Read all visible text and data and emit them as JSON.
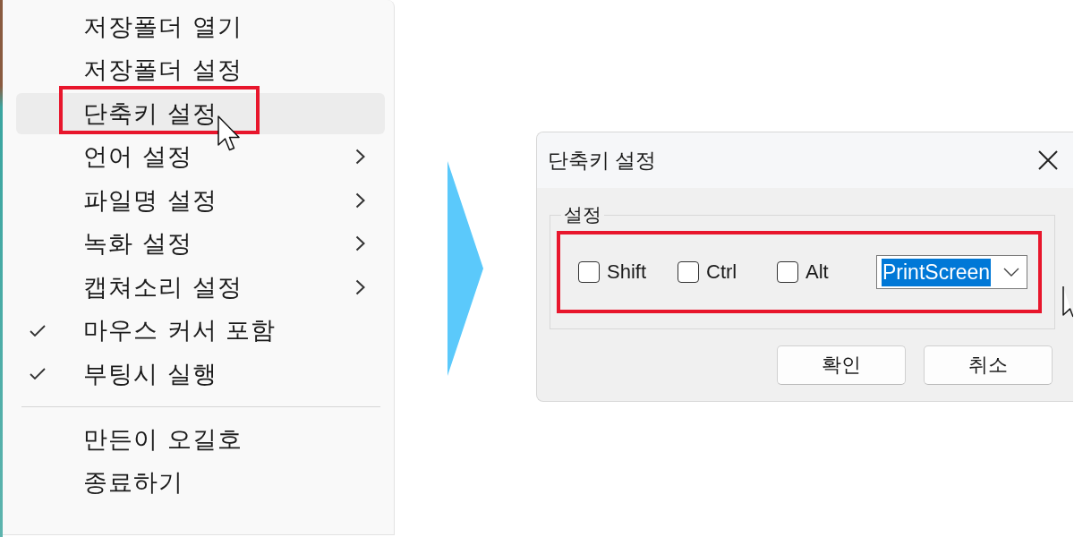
{
  "menu": {
    "items": [
      {
        "kind": "item",
        "label": "저장폴더 열기",
        "checked": false,
        "submenu": false,
        "selected": false,
        "framed": false
      },
      {
        "kind": "item",
        "label": "저장폴더 설정",
        "checked": false,
        "submenu": false,
        "selected": false,
        "framed": false
      },
      {
        "kind": "item",
        "label": "단축키 설정",
        "checked": false,
        "submenu": false,
        "selected": true,
        "framed": true
      },
      {
        "kind": "item",
        "label": "언어 설정",
        "checked": false,
        "submenu": true,
        "selected": false,
        "framed": false
      },
      {
        "kind": "item",
        "label": "파일명 설정",
        "checked": false,
        "submenu": true,
        "selected": false,
        "framed": false
      },
      {
        "kind": "item",
        "label": "녹화 설정",
        "checked": false,
        "submenu": true,
        "selected": false,
        "framed": false
      },
      {
        "kind": "item",
        "label": "캡쳐소리 설정",
        "checked": false,
        "submenu": true,
        "selected": false,
        "framed": false
      },
      {
        "kind": "item",
        "label": "마우스 커서 포함",
        "checked": true,
        "submenu": false,
        "selected": false,
        "framed": false
      },
      {
        "kind": "item",
        "label": "부팅시 실행",
        "checked": true,
        "submenu": false,
        "selected": false,
        "framed": false
      },
      {
        "kind": "separator"
      },
      {
        "kind": "item",
        "label": "만든이 오길호",
        "checked": false,
        "submenu": false,
        "selected": false,
        "framed": false
      },
      {
        "kind": "item",
        "label": "종료하기",
        "checked": false,
        "submenu": false,
        "selected": false,
        "framed": false
      }
    ]
  },
  "dialog": {
    "title": "단축키 설정",
    "group": {
      "label": "설정",
      "framed": true,
      "modifiers": [
        {
          "label": "Shift",
          "checked": false
        },
        {
          "label": "Ctrl",
          "checked": false
        },
        {
          "label": "Alt",
          "checked": false
        }
      ],
      "key": {
        "value": "PrintScreen",
        "highlighted": true
      }
    },
    "buttons": [
      "확인",
      "취소"
    ]
  }
}
